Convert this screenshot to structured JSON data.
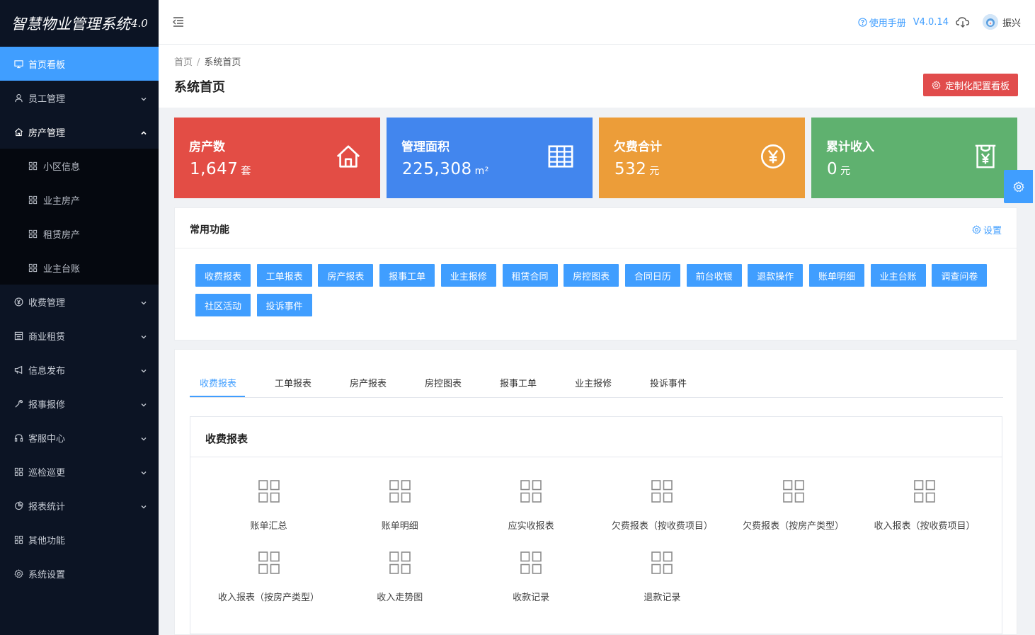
{
  "app": {
    "title": "智慧物业管理系统",
    "version_badge": "4.0"
  },
  "sidebar": {
    "items": [
      {
        "label": "首页看板",
        "icon": "monitor-icon",
        "active": true
      },
      {
        "label": "员工管理",
        "icon": "user-icon"
      },
      {
        "label": "房产管理",
        "icon": "home-icon",
        "expanded": true,
        "children": [
          {
            "label": "小区信息",
            "icon": "grid-icon"
          },
          {
            "label": "业主房产",
            "icon": "grid-icon"
          },
          {
            "label": "租赁房产",
            "icon": "grid-icon"
          },
          {
            "label": "业主台账",
            "icon": "grid-icon"
          }
        ]
      },
      {
        "label": "收费管理",
        "icon": "yen-circle-icon"
      },
      {
        "label": "商业租赁",
        "icon": "register-icon"
      },
      {
        "label": "信息发布",
        "icon": "megaphone-icon"
      },
      {
        "label": "报事报修",
        "icon": "wrench-icon"
      },
      {
        "label": "客服中心",
        "icon": "headset-icon"
      },
      {
        "label": "巡检巡更",
        "icon": "grid-icon"
      },
      {
        "label": "报表统计",
        "icon": "pie-chart-icon"
      },
      {
        "label": "其他功能",
        "icon": "grid-icon"
      },
      {
        "label": "系统设置",
        "icon": "gear-icon"
      }
    ]
  },
  "header": {
    "manual_label": "使用手册",
    "version": "V4.0.14",
    "username": "振兴"
  },
  "breadcrumb": {
    "home": "首页",
    "separator": "/",
    "current": "系统首页"
  },
  "page": {
    "title": "系统首页",
    "customize_button": "定制化配置看板"
  },
  "stats": [
    {
      "label": "房产数",
      "value": "1,647",
      "unit": "套",
      "color": "#e34d45",
      "icon": "house-icon"
    },
    {
      "label": "管理面积",
      "value": "225,308",
      "unit": "m²",
      "color": "#4286ee",
      "icon": "table-icon"
    },
    {
      "label": "欠费合计",
      "value": "532",
      "unit": "元",
      "color": "#ec9d39",
      "icon": "yen-circle-icon"
    },
    {
      "label": "累计收入",
      "value": "0",
      "unit": "元",
      "color": "#5fb16f",
      "icon": "yen-bag-icon"
    }
  ],
  "quick": {
    "title": "常用功能",
    "settings_label": "设置",
    "buttons": [
      "收费报表",
      "工单报表",
      "房产报表",
      "报事工单",
      "业主报修",
      "租赁合同",
      "房控图表",
      "合同日历",
      "前台收银",
      "退款操作",
      "账单明细",
      "业主台账",
      "调查问卷",
      "社区活动",
      "投诉事件"
    ]
  },
  "reports": {
    "tabs": [
      "收费报表",
      "工单报表",
      "房产报表",
      "房控图表",
      "报事工单",
      "业主报修",
      "投诉事件"
    ],
    "active_tab": 0,
    "box_title": "收费报表",
    "items": [
      "账单汇总",
      "账单明细",
      "应实收报表",
      "欠费报表（按收费项目）",
      "欠费报表（按房产类型）",
      "收入报表（按收费项目）",
      "收入报表（按房产类型）",
      "收入走势图",
      "收款记录",
      "退款记录"
    ]
  },
  "colors": {
    "primary": "#409eff",
    "sidebar_bg": "#0c1424",
    "danger": "#e14c4c"
  }
}
